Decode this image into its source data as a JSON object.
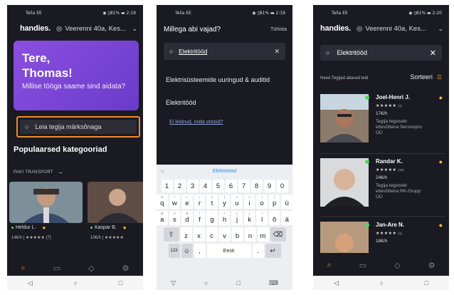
{
  "status": {
    "left": "Telia EE",
    "battery_left": "81%",
    "time1": "2:19",
    "time2": "2:19",
    "time3": "2:20"
  },
  "app": {
    "brand": "handies.",
    "location": "Veerenni 40a, Kes..."
  },
  "screen1": {
    "greeting": "Tere,",
    "name": "Thomas!",
    "question": "Millise tööga saame sind aidata?",
    "search_placeholder": "Leia tegija märksõnaga",
    "section_title": "Populaarsed kategooriad",
    "subcategory": "PAKI TRANSPORT",
    "cards": [
      {
        "name": "Heldur L.",
        "price": "14€/h",
        "stars": "★★★★★",
        "count": "(7)"
      },
      {
        "name": "Kaspar B.",
        "price": "10€/h",
        "stars": "★★★★★"
      }
    ]
  },
  "screen2": {
    "title": "Millega abi vajad?",
    "close": "Tühista",
    "search_value": "Elektritööd",
    "suggestions": [
      "Elektrisüsteemide uuringud & auditid",
      "Elektritööd"
    ],
    "not_found": "Ei leidnud, mida otsisid?",
    "keyboard_suggestion": "Elektritööd",
    "space_label": "Eesti",
    "sym_label": "123"
  },
  "screen3": {
    "search_value": "Elektritööd",
    "hint": "Need Tegijad aitavad teid",
    "sort_label": "Sorteeri",
    "pros": [
      {
        "name": "Joel-Henri J.",
        "stars": "★★★★★",
        "count": "(1)",
        "price": "17€/h",
        "company": "Tegija tegutseb ettevõttena Servicepro OÜ"
      },
      {
        "name": "Randar K.",
        "stars": "★★★★★",
        "count": "(16)",
        "price": "24€/h",
        "company": "Tegija tegutseb ettevõttena RK-Grupp OÜ"
      },
      {
        "name": "Jan-Are N.",
        "stars": "★★★★★",
        "count": "(1)",
        "price": "18€/h"
      }
    ]
  },
  "colors": {
    "accent": "#f08a2a",
    "hero": "#7b45d6",
    "online": "#4cd964",
    "bg": "#1a1a22"
  }
}
